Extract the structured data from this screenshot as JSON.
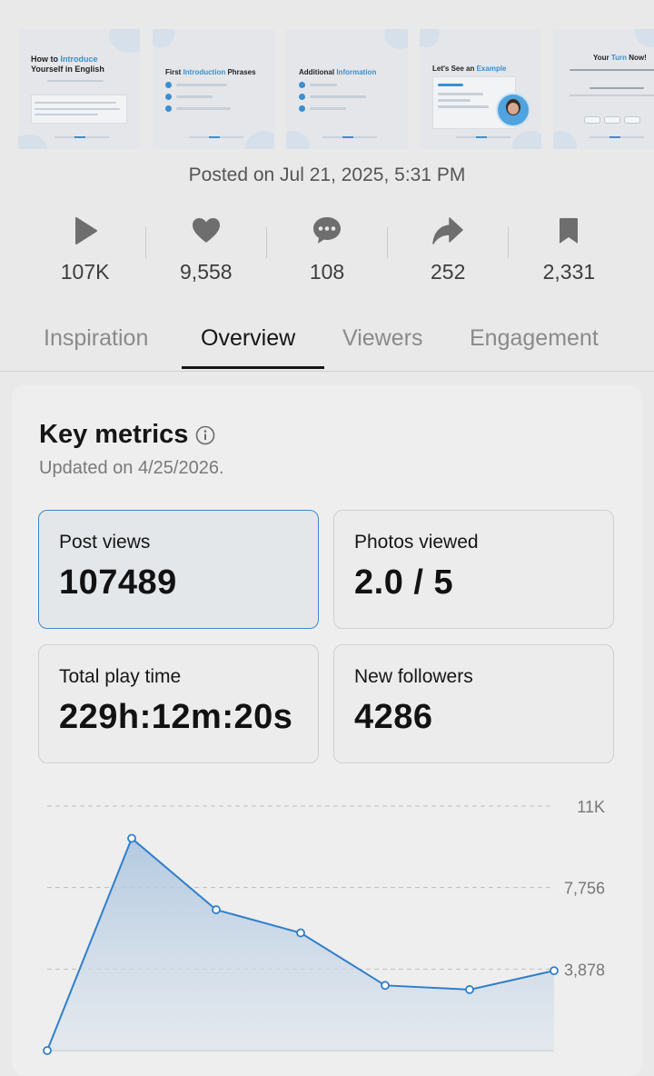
{
  "thumbnails": [
    {
      "title_pre": "How to ",
      "title_hl": "Introduce",
      "title_post": "Yourself in English"
    },
    {
      "title_pre": "First ",
      "title_hl": "Introduction",
      "title_post": " Phrases"
    },
    {
      "title_pre": "Additional ",
      "title_hl": "Information",
      "title_post": ""
    },
    {
      "title_pre": "Let's See an ",
      "title_hl": "Example",
      "title_post": ""
    },
    {
      "title_pre": "Your ",
      "title_hl": "Turn",
      "title_post": " Now!"
    }
  ],
  "posted": "Posted on Jul 21, 2025, 5:31 PM",
  "stats": [
    {
      "icon": "play-icon",
      "value": "107K"
    },
    {
      "icon": "heart-icon",
      "value": "9,558"
    },
    {
      "icon": "comment-icon",
      "value": "108"
    },
    {
      "icon": "share-icon",
      "value": "252"
    },
    {
      "icon": "bookmark-icon",
      "value": "2,331"
    }
  ],
  "tabs": [
    {
      "label": "Inspiration",
      "active": false
    },
    {
      "label": "Overview",
      "active": true
    },
    {
      "label": "Viewers",
      "active": false
    },
    {
      "label": "Engagement",
      "active": false
    }
  ],
  "key_metrics": {
    "title": "Key metrics",
    "updated": "Updated on 4/25/2026.",
    "cards": [
      {
        "label": "Post views",
        "value": "107489",
        "selected": true
      },
      {
        "label": "Photos viewed",
        "value": "2.0 / 5",
        "selected": false
      },
      {
        "label": "Total play time",
        "value": "229h:12m:20s",
        "selected": false
      },
      {
        "label": "New followers",
        "value": "4286",
        "selected": false
      }
    ]
  },
  "colors": {
    "accent": "#2f7fcb",
    "selected_border": "#3f89cc"
  },
  "chart_data": {
    "type": "area",
    "title": "",
    "xlabel": "",
    "ylabel": "",
    "x": [
      1,
      2,
      3,
      4,
      5,
      6,
      7
    ],
    "series": [
      {
        "values": [
          0,
          10100,
          6700,
          5600,
          3100,
          2900,
          3800
        ]
      }
    ],
    "ylim": [
      0,
      11634
    ],
    "yticks": [
      3878,
      7756,
      11634
    ],
    "ytick_labels": [
      "3,878",
      "7,756",
      "11K"
    ],
    "grid": true
  }
}
